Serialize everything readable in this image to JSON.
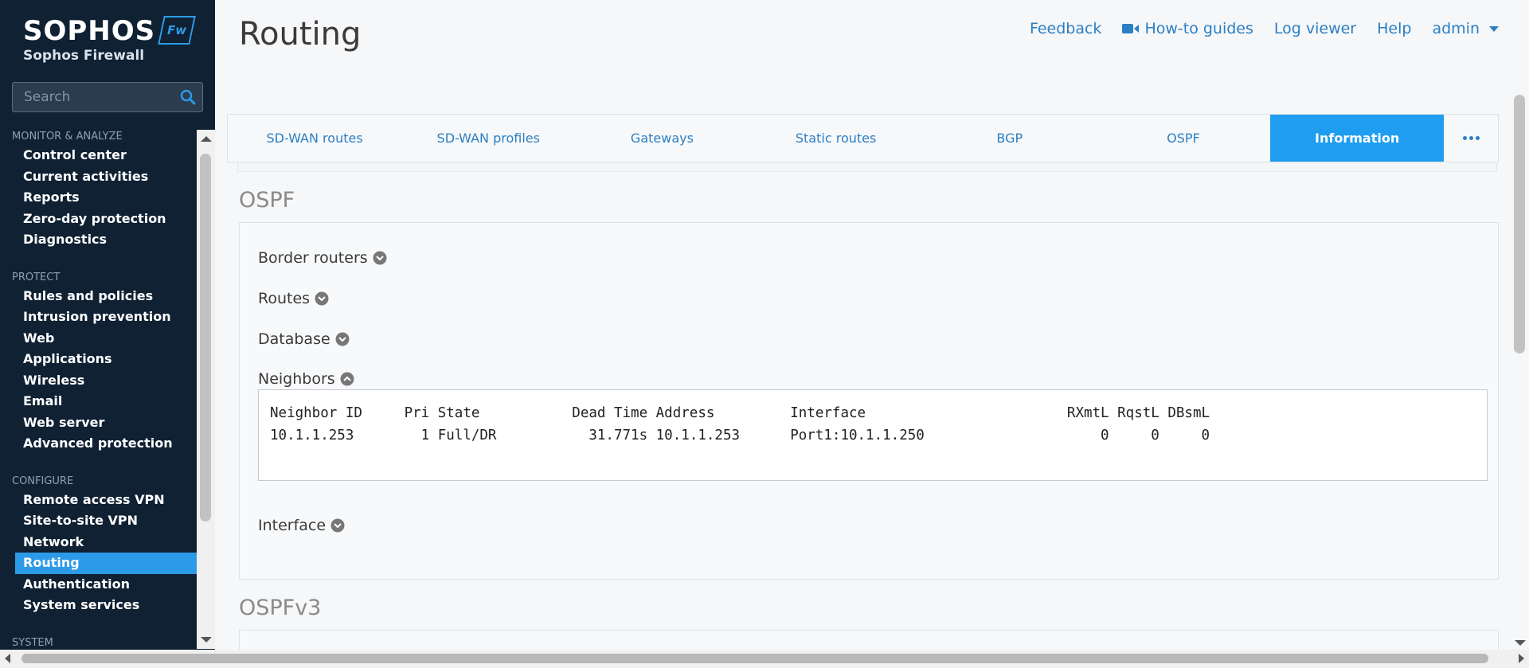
{
  "brand": {
    "name": "SOPHOS",
    "product": "Sophos Firewall",
    "badge": "Fw"
  },
  "search": {
    "placeholder": "Search"
  },
  "sidebar": {
    "sections": [
      {
        "title": "MONITOR & ANALYZE",
        "items": [
          "Control center",
          "Current activities",
          "Reports",
          "Zero-day protection",
          "Diagnostics"
        ]
      },
      {
        "title": "PROTECT",
        "items": [
          "Rules and policies",
          "Intrusion prevention",
          "Web",
          "Applications",
          "Wireless",
          "Email",
          "Web server",
          "Advanced protection"
        ]
      },
      {
        "title": "CONFIGURE",
        "items": [
          "Remote access VPN",
          "Site-to-site VPN",
          "Network",
          "Routing",
          "Authentication",
          "System services"
        ]
      },
      {
        "title": "SYSTEM",
        "items": []
      }
    ],
    "active_item": "Routing"
  },
  "header": {
    "title": "Routing",
    "links": {
      "feedback": "Feedback",
      "howto": "How-to guides",
      "logviewer": "Log viewer",
      "help": "Help",
      "user": "admin"
    }
  },
  "tabs": {
    "items": [
      "SD-WAN routes",
      "SD-WAN profiles",
      "Gateways",
      "Static routes",
      "BGP",
      "OSPF",
      "Information"
    ],
    "active": "Information"
  },
  "ospf": {
    "title": "OSPF",
    "accordions": {
      "border_routers": "Border routers",
      "routes": "Routes",
      "database": "Database",
      "neighbors": "Neighbors",
      "interface": "Interface"
    },
    "neighbors_output": "Neighbor ID     Pri State           Dead Time Address         Interface                        RXmtL RqstL DBsmL\n10.1.1.253        1 Full/DR           31.771s 10.1.1.253      Port1:10.1.1.250                     0     0     0"
  },
  "ospfv3": {
    "title": "OSPFv3"
  },
  "colors": {
    "sidebar_bg": "#0f2133",
    "accent": "#1f9df0",
    "link": "#2a7fc5"
  }
}
